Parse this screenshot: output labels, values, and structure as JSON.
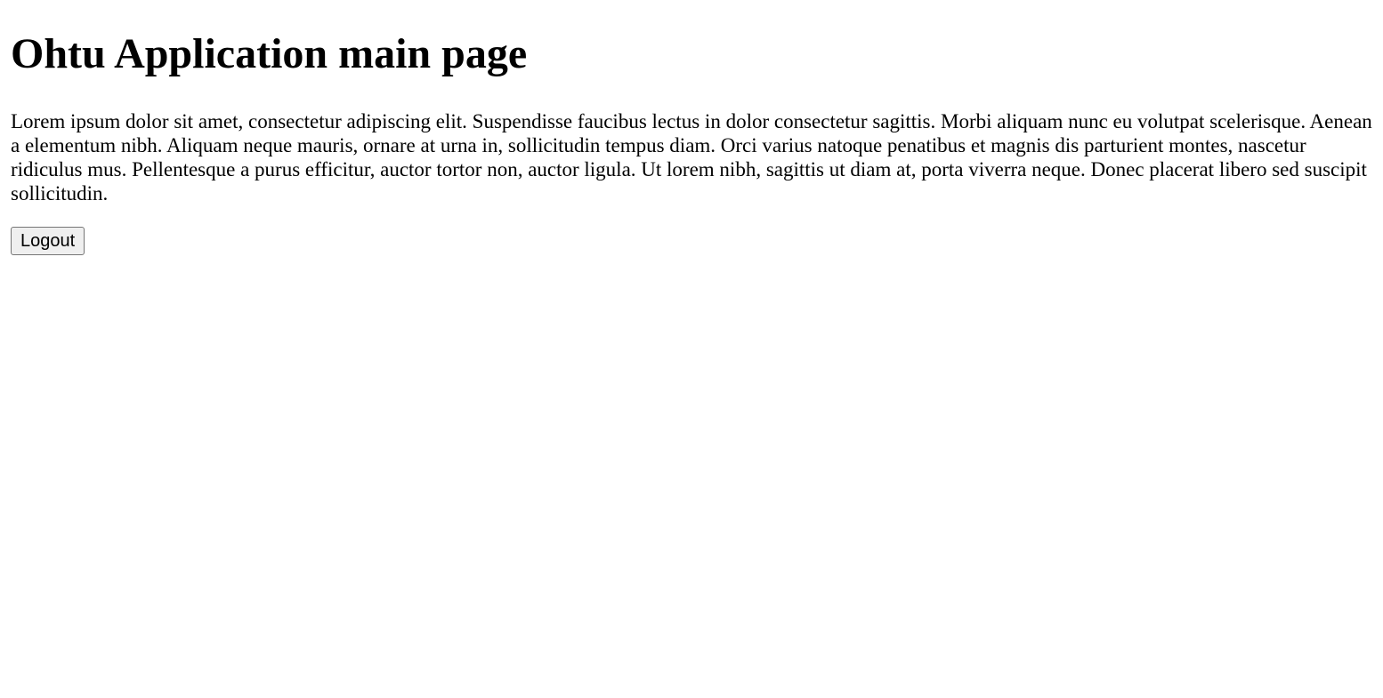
{
  "page": {
    "title": "Ohtu Application main page",
    "paragraph": "Lorem ipsum dolor sit amet, consectetur adipiscing elit. Suspendisse faucibus lectus in dolor consectetur sagittis. Morbi aliquam nunc eu volutpat scelerisque. Aenean a elementum nibh. Aliquam neque mauris, ornare at urna in, sollicitudin tempus diam. Orci varius natoque penatibus et magnis dis parturient montes, nascetur ridiculus mus. Pellentesque a purus efficitur, auctor tortor non, auctor ligula. Ut lorem nibh, sagittis ut diam at, porta viverra neque. Donec placerat libero sed suscipit sollicitudin.",
    "logout_label": "Logout"
  },
  "colors": {
    "background": "#ffffff",
    "text": "#000000",
    "button_background": "#efefef",
    "button_border": "#767676"
  }
}
